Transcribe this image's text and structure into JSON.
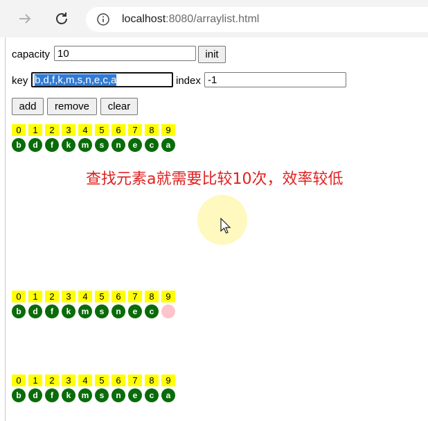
{
  "browser": {
    "url_host": "localhost",
    "url_rest": ":8080/arraylist.html",
    "back_icon": "arrow-right-icon",
    "reload_icon": "reload-icon",
    "info_icon": "info-icon"
  },
  "form": {
    "capacity_label": "capacity",
    "capacity_value": "10",
    "init_label": "init",
    "key_label": "key",
    "key_value": "b,d,f,k,m,s,n,e,c,a",
    "index_label": "index",
    "index_value": "-1",
    "add_label": "add",
    "remove_label": "remove",
    "clear_label": "clear"
  },
  "caption": "查找元素a就需要比较10次，效率较低",
  "arrays": [
    {
      "indices": [
        "0",
        "1",
        "2",
        "3",
        "4",
        "5",
        "6",
        "7",
        "8",
        "9"
      ],
      "items": [
        {
          "v": "b",
          "found": false
        },
        {
          "v": "d",
          "found": false
        },
        {
          "v": "f",
          "found": false
        },
        {
          "v": "k",
          "found": false
        },
        {
          "v": "m",
          "found": false
        },
        {
          "v": "s",
          "found": false
        },
        {
          "v": "n",
          "found": false
        },
        {
          "v": "e",
          "found": false
        },
        {
          "v": "c",
          "found": false
        },
        {
          "v": "a",
          "found": false
        }
      ]
    },
    {
      "indices": [
        "0",
        "1",
        "2",
        "3",
        "4",
        "5",
        "6",
        "7",
        "8",
        "9"
      ],
      "items": [
        {
          "v": "b",
          "found": false
        },
        {
          "v": "d",
          "found": false
        },
        {
          "v": "f",
          "found": false
        },
        {
          "v": "k",
          "found": false
        },
        {
          "v": "m",
          "found": false
        },
        {
          "v": "s",
          "found": false
        },
        {
          "v": "n",
          "found": false
        },
        {
          "v": "e",
          "found": false
        },
        {
          "v": "c",
          "found": false
        },
        {
          "v": "",
          "found": true
        }
      ]
    },
    {
      "indices": [
        "0",
        "1",
        "2",
        "3",
        "4",
        "5",
        "6",
        "7",
        "8",
        "9"
      ],
      "items": [
        {
          "v": "b",
          "found": false
        },
        {
          "v": "d",
          "found": false
        },
        {
          "v": "f",
          "found": false
        },
        {
          "v": "k",
          "found": false
        },
        {
          "v": "m",
          "found": false
        },
        {
          "v": "s",
          "found": false
        },
        {
          "v": "n",
          "found": false
        },
        {
          "v": "e",
          "found": false
        },
        {
          "v": "c",
          "found": false
        },
        {
          "v": "a",
          "found": false
        }
      ]
    }
  ],
  "colors": {
    "index_cell": "#ffff00",
    "element": "#0a6b0a",
    "highlight": "#ffc3cb",
    "caption": "#e02020"
  }
}
